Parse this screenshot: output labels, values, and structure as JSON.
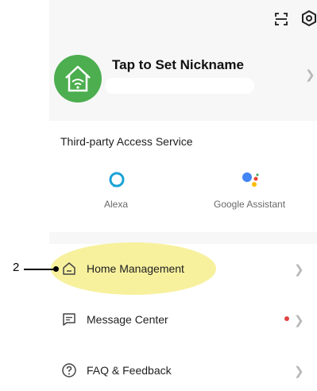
{
  "header": {
    "nickname": "Tap to Set Nickname"
  },
  "third_party": {
    "title": "Third-party Access Service",
    "services": [
      {
        "label": "Alexa",
        "icon": "alexa-icon"
      },
      {
        "label": "Google Assistant",
        "icon": "google-assistant-icon"
      }
    ]
  },
  "menu": {
    "items": [
      {
        "label": "Home Management",
        "icon": "home-icon"
      },
      {
        "label": "Message Center",
        "icon": "message-icon",
        "has_notification": true
      },
      {
        "label": "FAQ & Feedback",
        "icon": "help-icon"
      }
    ]
  },
  "annotation": {
    "callout_number": "2"
  },
  "colors": {
    "avatar_green": "#4cae4f",
    "highlight_yellow": "#f6f094",
    "notification_red": "#e04343",
    "alexa_blue": "#1aa3d6"
  }
}
